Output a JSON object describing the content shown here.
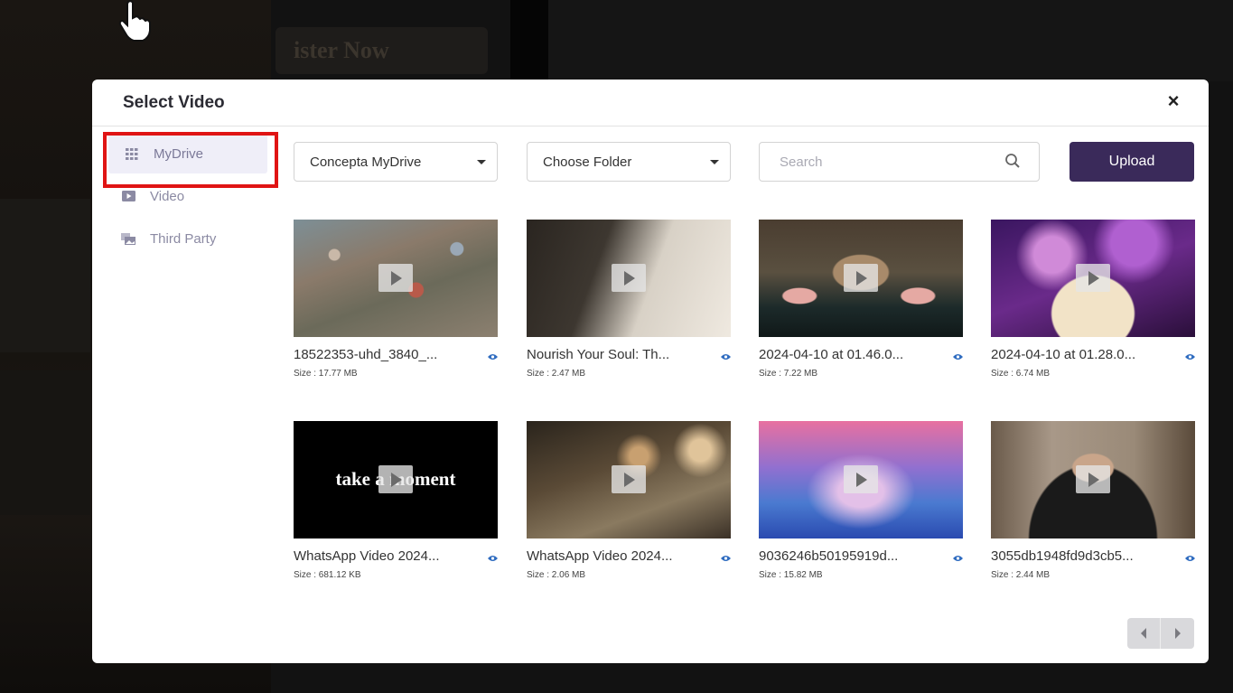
{
  "background": {
    "register_label": "ister Now"
  },
  "modal": {
    "title": "Select Video",
    "close_label": "×"
  },
  "sidebar": {
    "items": [
      {
        "label": "MyDrive",
        "icon": "grid-icon",
        "active": true
      },
      {
        "label": "Video",
        "icon": "video-icon",
        "active": false
      },
      {
        "label": "Third Party",
        "icon": "gallery-icon",
        "active": false
      }
    ]
  },
  "toolbar": {
    "drive_select": "Concepta MyDrive",
    "folder_select": "Choose Folder",
    "search_placeholder": "Search",
    "upload_label": "Upload"
  },
  "videos": [
    {
      "title": "18522353-uhd_3840_...",
      "size": "Size : 17.77 MB"
    },
    {
      "title": "Nourish Your Soul: Th...",
      "size": "Size : 2.47 MB"
    },
    {
      "title": "2024-04-10 at 01.46.0...",
      "size": "Size : 7.22 MB"
    },
    {
      "title": "2024-04-10 at 01.28.0...",
      "size": "Size : 6.74 MB"
    },
    {
      "title": "WhatsApp Video 2024...",
      "size": "Size : 681.12 KB",
      "overlay_text": "take a moment"
    },
    {
      "title": "WhatsApp Video 2024...",
      "size": "Size : 2.06 MB"
    },
    {
      "title": "9036246b50195919d...",
      "size": "Size : 15.82 MB"
    },
    {
      "title": "3055db1948fd9d3cb5...",
      "size": "Size : 2.44 MB"
    }
  ],
  "colors": {
    "accent": "#3a2a5a",
    "highlight": "#e01414",
    "sidebar_active_bg": "#efeef8",
    "eye_icon": "#2f6cc0"
  }
}
